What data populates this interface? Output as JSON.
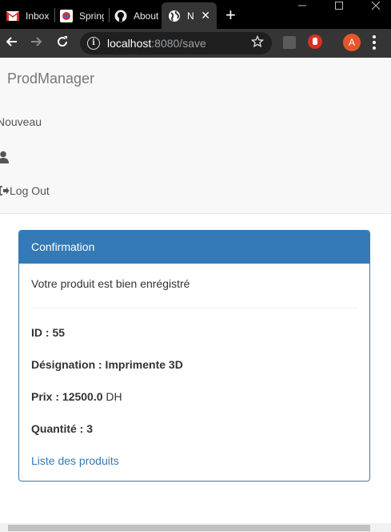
{
  "browser": {
    "tabs": [
      {
        "title": "Inbox",
        "icon": "gmail-icon"
      },
      {
        "title": "Spring",
        "icon": "spring-icon"
      },
      {
        "title": "About",
        "icon": "github-icon"
      },
      {
        "title": "N",
        "icon": "globe-icon",
        "active": true
      }
    ],
    "url_host": "localhost",
    "url_path": ":8080/save",
    "avatar_letter": "A",
    "close_glyph": "✕",
    "newtab_glyph": "+"
  },
  "navbar": {
    "brand": "ProdManager",
    "links": {
      "new": "Nouveau",
      "logout": "Log Out"
    }
  },
  "panel": {
    "heading": "Confirmation",
    "message": "Votre produit est bien enrégistré",
    "fields": {
      "id_label": "ID : 55",
      "designation_label": "Désignation : Imprimente 3D",
      "price_label": "Prix : 12500.0",
      "price_unit": "DH",
      "quantity_label": "Quantité : 3"
    },
    "link": "Liste des produits"
  },
  "colors": {
    "primary": "#337ab7",
    "navbar_bg": "#f8f8f8",
    "chrome_dark": "#353535"
  }
}
